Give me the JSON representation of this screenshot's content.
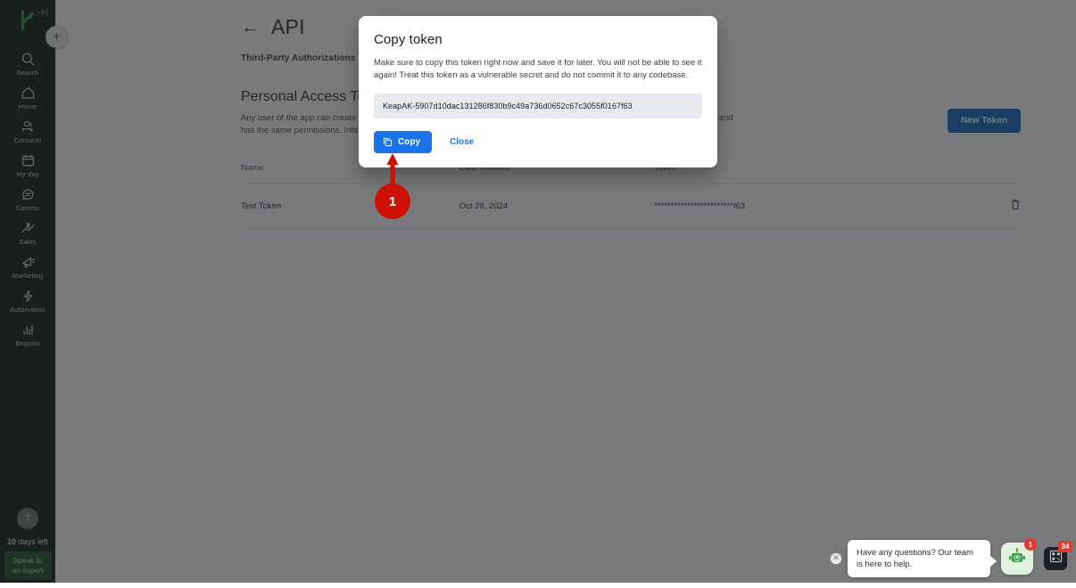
{
  "sidebar": {
    "brand": {
      "logo_icon": "keap-logo",
      "collapse_icon": "collapse-panel-icon"
    },
    "fab_label": "+",
    "items": [
      {
        "label": "Search",
        "icon": "search-icon"
      },
      {
        "label": "Home",
        "icon": "home-icon"
      },
      {
        "label": "Contacts",
        "icon": "contacts-icon"
      },
      {
        "label": "My day",
        "icon": "calendar-icon"
      },
      {
        "label": "Comms",
        "icon": "chat-icon"
      },
      {
        "label": "Sales",
        "icon": "sales-chart-icon"
      },
      {
        "label": "Marketing",
        "icon": "megaphone-icon"
      },
      {
        "label": "Automation",
        "icon": "lightning-bolt-icon"
      },
      {
        "label": "Reports",
        "icon": "bar-chart-icon"
      }
    ],
    "avatar_initial": "T",
    "days_left_count": "10",
    "days_left_suffix": " days left",
    "expert_button_line1": "Speak to",
    "expert_button_line2": "an expert"
  },
  "page": {
    "back_icon": "back-arrow-icon",
    "title": "API",
    "tabs": [
      {
        "label": "Third-Party Authorizations",
        "active": false
      },
      {
        "label": "Personal Access Tokens",
        "active": true
      }
    ],
    "section_title": "Personal Access Tokens",
    "section_desc": "Any user of the app can create a Personal Access Token. A Personal Access Token operates under the user of whom created it and has the same permissions. Intended for casual/entry level use.",
    "new_token_button": "New Token",
    "table": {
      "columns": [
        "Name",
        "Date Created",
        "Token",
        ""
      ],
      "rows": [
        {
          "name": "Test Token",
          "date_created": "Oct 28, 2024",
          "token_masked": "************************f63",
          "delete_icon": "trash-icon"
        }
      ]
    }
  },
  "modal": {
    "title": "Copy token",
    "body": "Make sure to copy this token right now and save it for later. You will not be able to see it again! Treat this token as a vulnerable secret and do not commit it to any codebase.",
    "token_value": "KeapAK-5907d10dac131286f830b9c49a736d0652c67c3055f0167f63",
    "copy_button": "Copy",
    "copy_icon": "copy-icon",
    "close_button": "Close"
  },
  "annotation": {
    "step_number": "1",
    "marker_color": "#cc1100"
  },
  "chat": {
    "close_icon": "close-icon",
    "message": "Have any questions? Our team is here to help.",
    "bot_icon": "robot-icon",
    "bot_badge": "1",
    "qr_icon": "qr-code-icon",
    "qr_badge": "34"
  },
  "colors": {
    "sidebar_bg": "#101c16",
    "accent_blue": "#1a73e8",
    "new_token_blue": "#1668c2",
    "keap_green": "#2b6b33",
    "scrim": "rgba(32,33,36,0.6)"
  }
}
